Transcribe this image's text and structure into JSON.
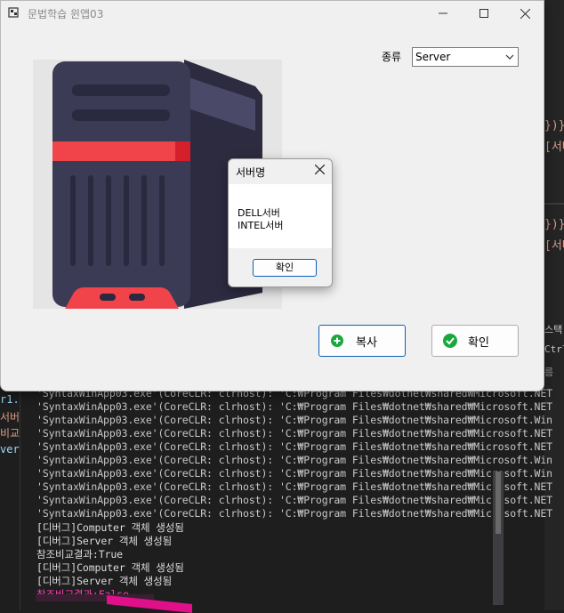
{
  "window": {
    "title": "문법학습 윈앱03",
    "kind_label": "종류",
    "kind_selected": "Server",
    "image_icon": "server-tower-icon",
    "buttons": {
      "copy": "복사",
      "ok": "확인"
    }
  },
  "message_box": {
    "title": "서버명",
    "lines": [
      "DELL서버",
      "INTEL서버"
    ],
    "ok": "확인"
  },
  "output": {
    "lines": [
      "'SyntaxWinApp03.exe'(CoreCLR: clrhost): 'C:₩Program Files₩dotnet₩shared₩Microsoft.NET",
      "'SyntaxWinApp03.exe'(CoreCLR: clrhost): 'C:₩Program Files₩dotnet₩shared₩Microsoft.NET",
      "'SyntaxWinApp03.exe'(CoreCLR: clrhost): 'C:₩Program Files₩dotnet₩shared₩Microsoft.Win",
      "'SyntaxWinApp03.exe'(CoreCLR: clrhost): 'C:₩Program Files₩dotnet₩shared₩Microsoft.NET",
      "'SyntaxWinApp03.exe'(CoreCLR: clrhost): 'C:₩Program Files₩dotnet₩shared₩Microsoft.NET",
      "'SyntaxWinApp03.exe'(CoreCLR: clrhost): 'C:₩Program Files₩dotnet₩shared₩Microsoft.Win",
      "'SyntaxWinApp03.exe'(CoreCLR: clrhost): 'C:₩Program Files₩dotnet₩shared₩Microsoft.Win",
      "'SyntaxWinApp03.exe'(CoreCLR: clrhost): 'C:₩Program Files₩dotnet₩shared₩Microsoft.NET",
      "'SyntaxWinApp03.exe'(CoreCLR: clrhost): 'C:₩Program Files₩dotnet₩shared₩Microsoft.NET",
      "'SyntaxWinApp03.exe'(CoreCLR: clrhost): 'C:₩Program Files₩dotnet₩shared₩Microsoft.NET",
      "[디버그]Computer 객체 생성됨",
      "[디버그]Server 객체 생성됨",
      "참조비교결과:True",
      "[디버그]Computer 객체 생성됨",
      "[디버그]Server 객체 생성됨",
      "참조비교결과:False"
    ]
  },
  "ide_fragments": {
    "right": [
      "})}\"",
      "[서버",
      "})}\"",
      "[서버",
      "스택",
      "Ctrl",
      "름"
    ],
    "left": [
      "r1.",
      "서버",
      "비교",
      "ver"
    ]
  },
  "colors": {
    "accent_blue": "#0e5fb8",
    "server_red": "#f0434a",
    "server_dark": "#3c3b56",
    "highlight_pink": "#ff3fb5"
  }
}
